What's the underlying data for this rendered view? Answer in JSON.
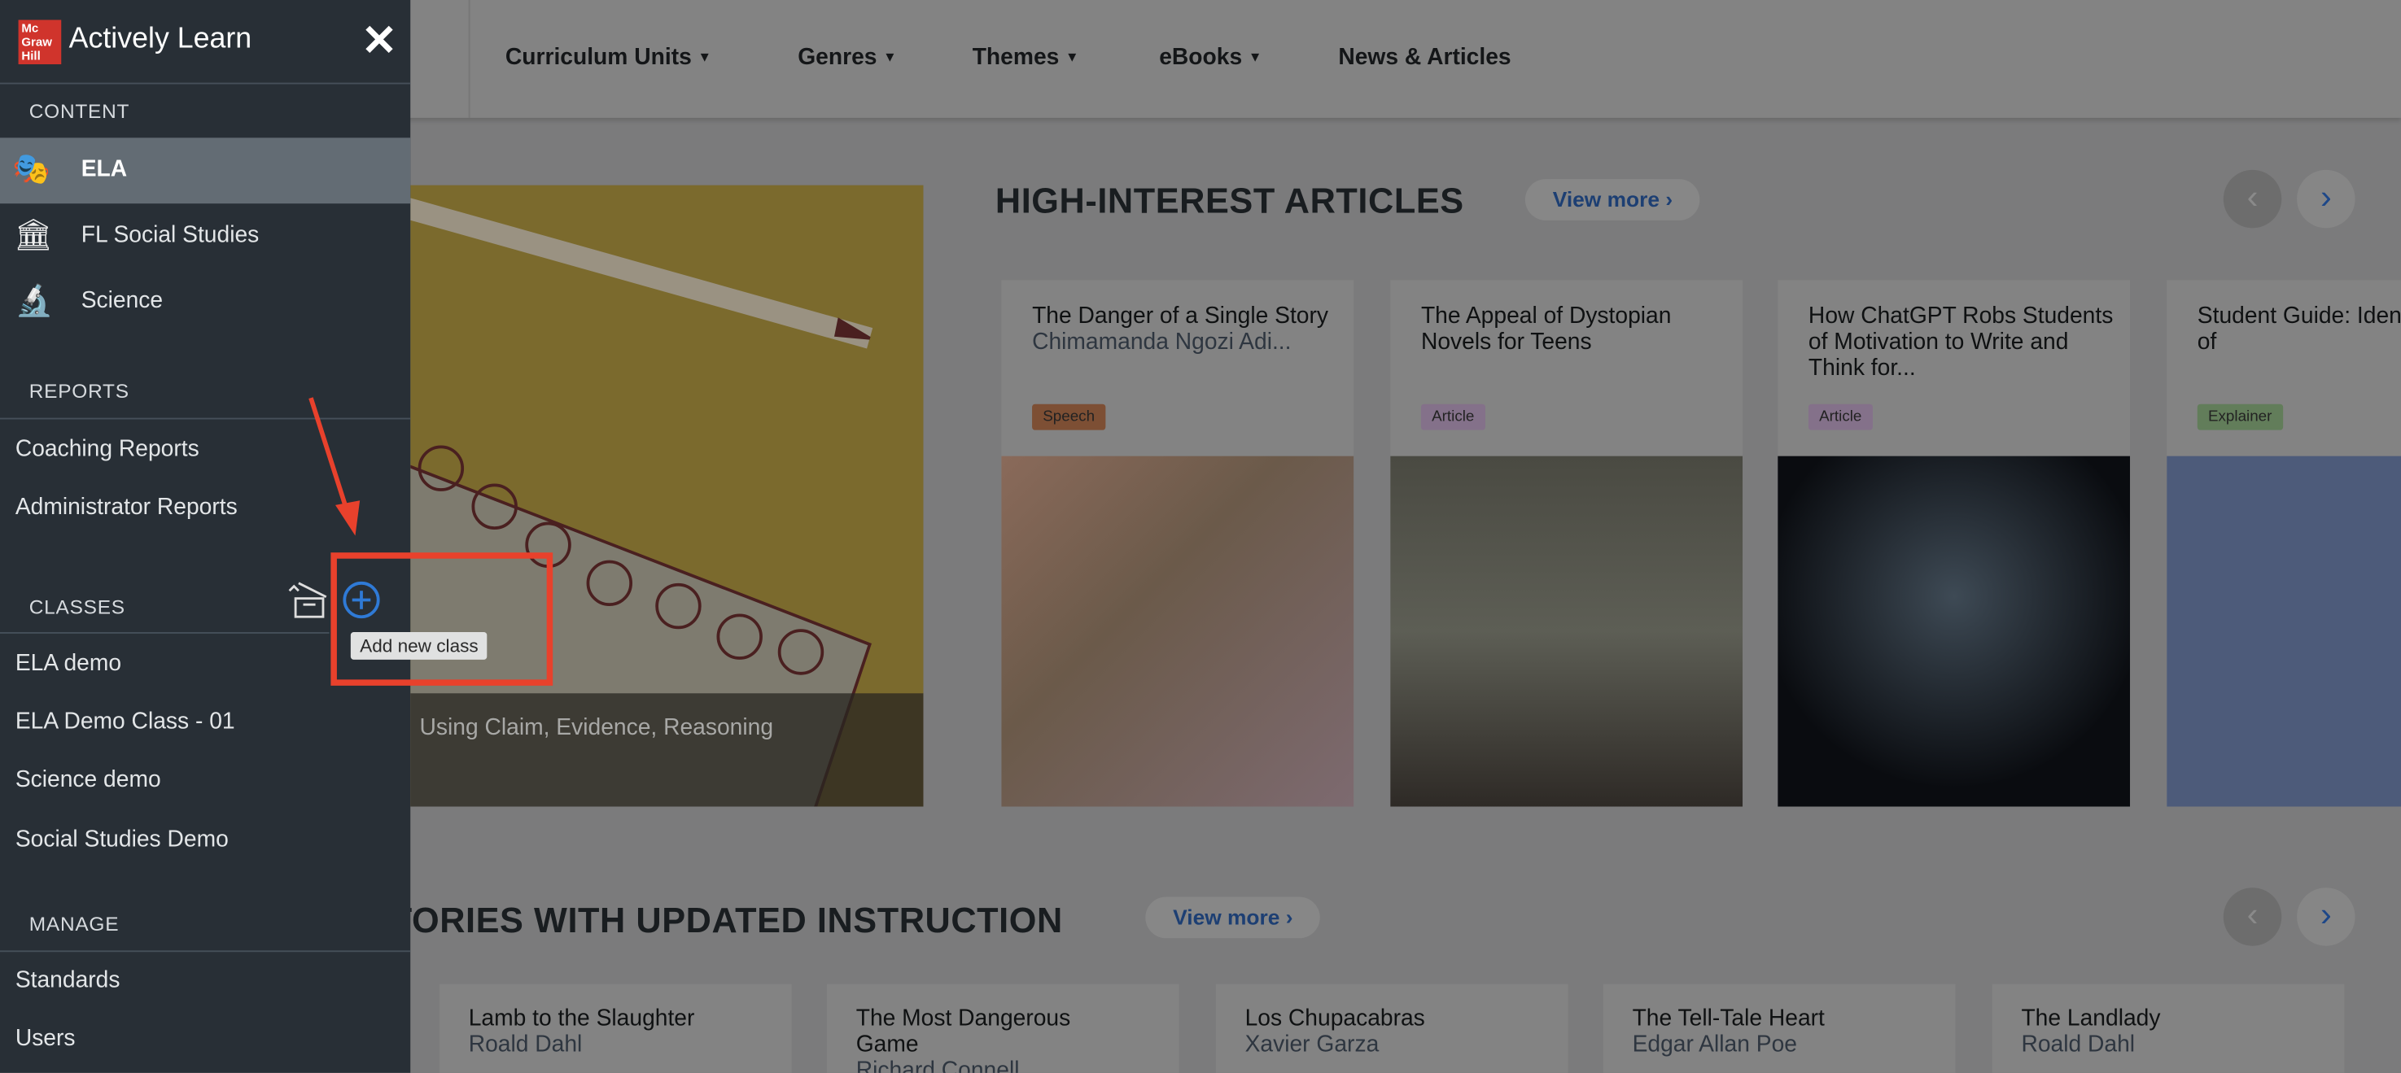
{
  "sidebar": {
    "brand": {
      "logo_text": "Mc Graw Hill",
      "product": "Actively Learn"
    },
    "close_icon": "close-icon",
    "content_heading": "CONTENT",
    "content_items": [
      {
        "label": "ELA",
        "icon": "theater-masks-icon",
        "active": true
      },
      {
        "label": "FL Social Studies",
        "icon": "museum-icon"
      },
      {
        "label": "Science",
        "icon": "microscope-icon"
      }
    ],
    "reports_heading": "REPORTS",
    "reports_items": [
      "Coaching Reports",
      "Administrator Reports"
    ],
    "classes_heading": "CLASSES",
    "archive_icon": "archive-box-icon",
    "add_class_icon": "plus-circle-icon",
    "add_class_tooltip": "Add new class",
    "classes": [
      "ELA demo",
      "ELA Demo Class - 01",
      "Science demo",
      "Social Studies Demo"
    ],
    "manage_heading": "MANAGE",
    "manage_items": [
      "Standards",
      "Users"
    ]
  },
  "nav": {
    "items": [
      "Curriculum Units",
      "Genres",
      "Themes",
      "eBooks",
      "News & Articles"
    ],
    "dropdown": [
      true,
      true,
      true,
      true,
      false
    ]
  },
  "feature": {
    "caption": "Using Claim, Evidence, Reasoning"
  },
  "section1": {
    "title": "HIGH-INTEREST ARTICLES",
    "view_more": "View more",
    "cards": [
      {
        "title": "The Danger of a Single Story",
        "author": "Chimamanda Ngozi Adi...",
        "tag": "Speech",
        "tag_color": "#7d4f34"
      },
      {
        "title": "The Appeal of Dystopian Novels for Teens",
        "author": "",
        "tag": "Article",
        "tag_color": "#84718a"
      },
      {
        "title": "How ChatGPT Robs Students of Motivation to Write and Think for...",
        "author": "",
        "tag": "Article",
        "tag_color": "#84718a"
      },
      {
        "title": "Student Guide: Identify Types of",
        "author": "",
        "tag": "Explainer",
        "tag_color": "#627d5a"
      }
    ]
  },
  "section2": {
    "title": "TORIES WITH UPDATED INSTRUCTION",
    "view_more": "View more",
    "cards": [
      {
        "title": "Lamb to the Slaughter",
        "author": "Roald Dahl"
      },
      {
        "title": "The Most Dangerous Game",
        "author": "Richard Connell"
      },
      {
        "title": "Los Chupacabras",
        "author": "Xavier Garza"
      },
      {
        "title": "The Tell-Tale Heart",
        "author": "Edgar Allan Poe"
      },
      {
        "title": "The Landlady",
        "author": "Roald Dahl"
      }
    ]
  },
  "colors": {
    "sidebar": "#282f36",
    "active_item": "#636c74",
    "accent": "#2f7ad6",
    "annotation": "#e8412c"
  }
}
